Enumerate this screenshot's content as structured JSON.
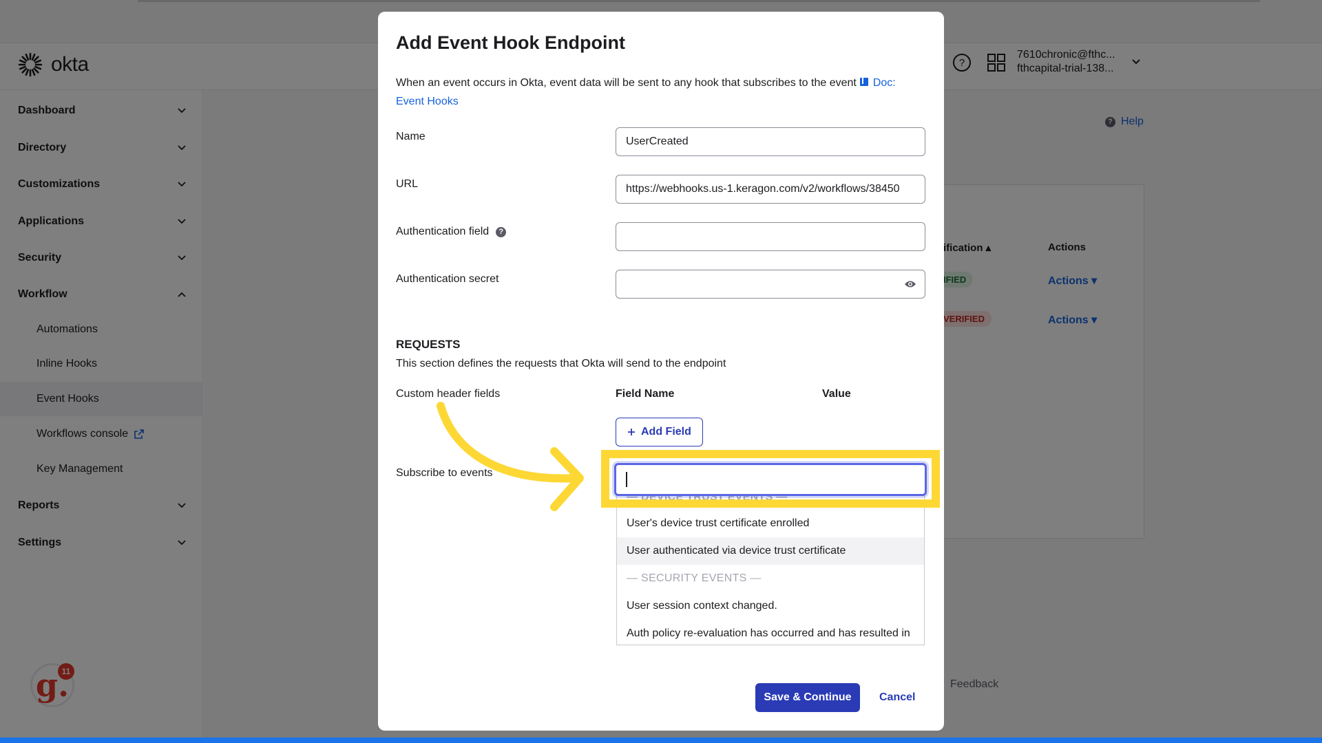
{
  "app": {
    "logo_text": "okta",
    "user_email": "7610chronic@fthc...",
    "user_org": "fthcapital-trial-138...",
    "help_label": "Help",
    "feedback_label": "Feedback"
  },
  "sidebar": {
    "items": [
      {
        "label": "Dashboard"
      },
      {
        "label": "Directory"
      },
      {
        "label": "Customizations"
      },
      {
        "label": "Applications"
      },
      {
        "label": "Security"
      },
      {
        "label": "Workflow"
      },
      {
        "label": "Reports"
      },
      {
        "label": "Settings"
      }
    ],
    "workflow_sub": [
      {
        "label": "Automations"
      },
      {
        "label": "Inline Hooks"
      },
      {
        "label": "Event Hooks"
      },
      {
        "label": "Workflows console"
      },
      {
        "label": "Key Management"
      }
    ]
  },
  "table": {
    "col_verification": "ification",
    "col_actions": "Actions",
    "rows": [
      {
        "status": "IFIED",
        "action": "Actions"
      },
      {
        "status": "VERIFIED",
        "action": "Actions"
      }
    ]
  },
  "modal": {
    "title": "Add Event Hook Endpoint",
    "desc_text": "When an event occurs in Okta, event data will be sent to any hook that subscribes to the event",
    "doc_link": "Doc: Event Hooks",
    "fields": {
      "name_label": "Name",
      "name_value": "UserCreated",
      "url_label": "URL",
      "url_value": "https://webhooks.us-1.keragon.com/v2/workflows/38450",
      "auth_field_label": "Authentication field",
      "auth_field_value": "",
      "auth_secret_label": "Authentication secret",
      "auth_secret_value": ""
    },
    "requests": {
      "title": "REQUESTS",
      "desc": "This section defines the requests that Okta will send to the endpoint",
      "custom_header_label": "Custom header fields",
      "col_field_name": "Field Name",
      "col_value": "Value",
      "add_field_label": "Add Field"
    },
    "subscribe": {
      "label": "Subscribe to events",
      "search_value": "",
      "options": [
        {
          "text": "— DEVICE TRUST EVENTS —",
          "group": true
        },
        {
          "text": "User's device trust certificate enrolled",
          "group": false
        },
        {
          "text": "User authenticated via device trust certificate",
          "group": false
        },
        {
          "text": "— SECURITY EVENTS —",
          "group": true
        },
        {
          "text": "User session context changed.",
          "group": false
        },
        {
          "text": "Auth policy re-evaluation has occurred and has resulted in",
          "group": false
        }
      ]
    },
    "save_label": "Save & Continue",
    "cancel_label": "Cancel"
  },
  "colors": {
    "primary": "#2a3bb5",
    "link": "#1662dd",
    "highlight": "#fdd835",
    "focus": "#5b66e4"
  },
  "guide": {
    "notification_count": "11",
    "avatar_letter": "g."
  }
}
